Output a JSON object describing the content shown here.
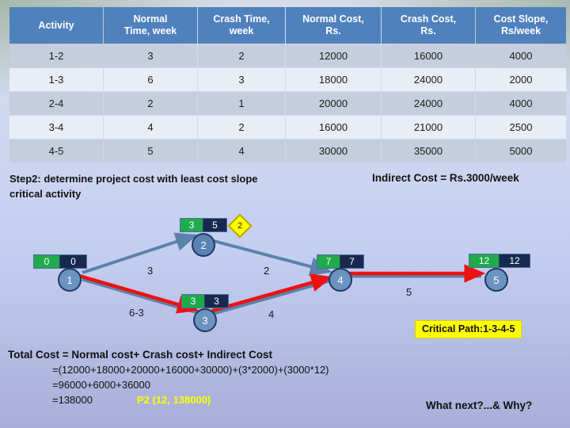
{
  "table": {
    "headers": [
      "Activity",
      "Normal Time, week",
      "Crash Time, week",
      "Normal Cost, Rs.",
      "Crash Cost, Rs.",
      "Cost Slope, Rs/week"
    ],
    "headers_lines": [
      [
        "Activity",
        ""
      ],
      [
        "Normal",
        "Time, week"
      ],
      [
        "Crash Time,",
        "week"
      ],
      [
        "Normal Cost,",
        "Rs."
      ],
      [
        "Crash Cost,",
        "Rs."
      ],
      [
        "Cost Slope,",
        "Rs/week"
      ]
    ],
    "rows": [
      {
        "activity": "1-2",
        "normal_time": "3",
        "crash_time": "2",
        "normal_cost": "12000",
        "crash_cost": "16000",
        "cost_slope": "4000"
      },
      {
        "activity": "1-3",
        "normal_time": "6",
        "crash_time": "3",
        "normal_cost": "18000",
        "crash_cost": "24000",
        "cost_slope": "2000"
      },
      {
        "activity": "2-4",
        "normal_time": "2",
        "crash_time": "1",
        "normal_cost": "20000",
        "crash_cost": "24000",
        "cost_slope": "4000"
      },
      {
        "activity": "3-4",
        "normal_time": "4",
        "crash_time": "2",
        "normal_cost": "16000",
        "crash_cost": "21000",
        "cost_slope": "2500"
      },
      {
        "activity": "4-5",
        "normal_time": "5",
        "crash_time": "4",
        "normal_cost": "30000",
        "crash_cost": "35000",
        "cost_slope": "5000"
      }
    ]
  },
  "step": {
    "line1": "Step2: determine project cost with least cost slope",
    "line2": "critical activity",
    "indirect_cost": "Indirect Cost = Rs.3000/week"
  },
  "diagram": {
    "nodes": [
      {
        "id": "1",
        "early": "0",
        "late": "0",
        "slack": null
      },
      {
        "id": "2",
        "early": "3",
        "late": "5",
        "slack": "2"
      },
      {
        "id": "3",
        "early": "3",
        "late": "3",
        "slack": null
      },
      {
        "id": "4",
        "early": "7",
        "late": "7",
        "slack": null
      },
      {
        "id": "5",
        "early": "12",
        "late": "12",
        "slack": null
      }
    ],
    "edges": [
      {
        "from": "1",
        "to": "2",
        "label": "3",
        "critical": false
      },
      {
        "from": "1",
        "to": "3",
        "label": "6-3",
        "critical": true
      },
      {
        "from": "2",
        "to": "4",
        "label": "2",
        "critical": false
      },
      {
        "from": "3",
        "to": "4",
        "label": "4",
        "critical": true
      },
      {
        "from": "4",
        "to": "5",
        "label": "5",
        "critical": true
      }
    ],
    "critical_path": "Critical Path:1-3-4-5",
    "colors": {
      "critical_edge": "#ee1111",
      "normal_edge": "#5b82ab",
      "node_fill": "#6a93c0",
      "node_stroke": "#1f3864",
      "early_badge": "#1faa4b",
      "late_badge": "#17294f",
      "slack_badge": "#ffff00"
    }
  },
  "calculations": {
    "line1": "Total Cost = Normal cost+  Crash cost+ Indirect Cost",
    "line2": "=(12000+18000+20000+16000+30000)+(3*2000)+(3000*12)",
    "line3": "=96000+6000+36000",
    "line4": "=138000",
    "point_label": "P2 (12, 138000)"
  },
  "footer": {
    "what_next": "What next?...&  Why?"
  }
}
